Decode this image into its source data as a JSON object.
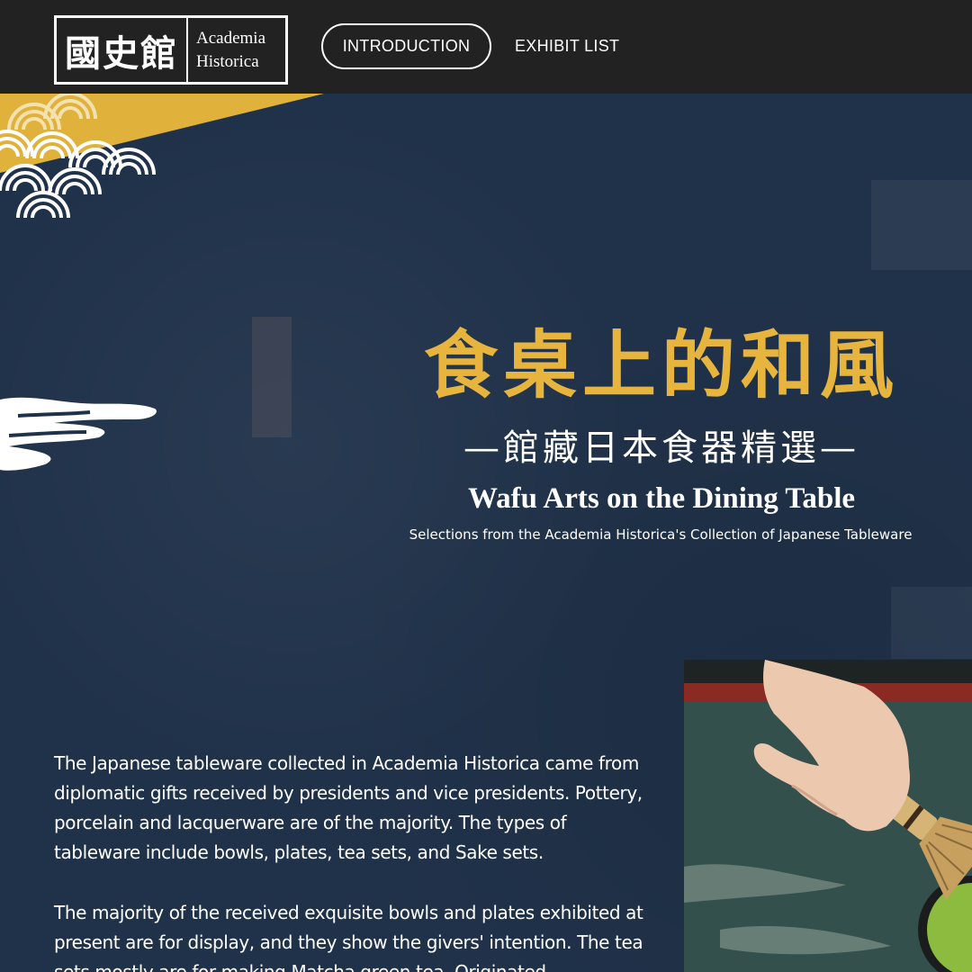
{
  "header": {
    "logo": {
      "cn": "國史館",
      "en_line1": "Academia",
      "en_line2": "Historica"
    },
    "nav": {
      "introduction": "INTRODUCTION",
      "exhibit_list": "EXHIBIT LIST"
    }
  },
  "hero": {
    "title_cn": "食桌上的和風",
    "subtitle_cn": "—館藏日本食器精選—",
    "title_en": "Wafu Arts on the Dining Table",
    "subtitle_en": "Selections from the Academia Historica's Collection of Japanese Tableware"
  },
  "intro": {
    "paragraph1": "The Japanese tableware collected in Academia Historica came from diplomatic gifts received by presidents and vice presidents. Pottery, porcelain and lacquerware are of the majority. The types of tableware include bowls, plates, tea sets, and Sake sets.",
    "paragraph2": "The majority of the received exquisite bowls and plates exhibited at present are for display, and they show the givers' intention. The tea sets mostly are for making Matcha green tea. Originated"
  },
  "colors": {
    "topbar": "#222222",
    "background": "#20324a",
    "accent_gold": "#e7b53d",
    "text": "#ffffff"
  },
  "icons": {
    "wave_pattern": "seigaiha-wave-icon",
    "cloud": "cloud-icon"
  }
}
